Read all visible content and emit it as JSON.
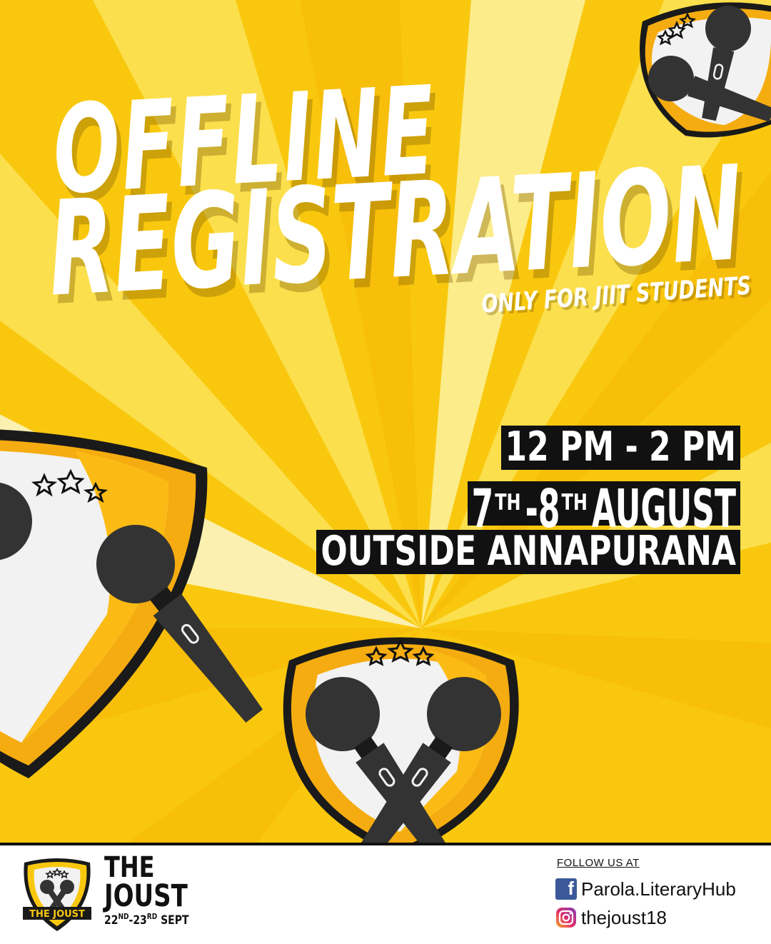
{
  "headline": {
    "line1": "OFFLINE",
    "line2": "REGISTRATION",
    "subline": "ONLY FOR JIIT STUDENTS"
  },
  "details": {
    "time": "12 PM - 2 PM",
    "date_day1": "7",
    "date_day1_suffix": "TH",
    "date_dash": " - ",
    "date_day2": "8",
    "date_day2_suffix": "TH",
    "date_month": "AUGUST",
    "venue": "OUTSIDE ANNAPURANA"
  },
  "footer": {
    "logo_banner": "THE JOUST",
    "brand_line1": "THE",
    "brand_line2": "JOUST",
    "dates_start": "22",
    "dates_start_suffix": "ND",
    "dates_dash": "-",
    "dates_end": "23",
    "dates_end_suffix": "RD",
    "dates_month": "SEPT",
    "follow_label": "FOLLOW US AT",
    "facebook_handle": "Parola.LiteraryHub",
    "instagram_handle": "thejoust18"
  },
  "icons": [
    "microphone-icon",
    "star-icon",
    "shield-icon",
    "facebook-icon",
    "instagram-icon"
  ],
  "colors": {
    "yellow": "#F9C80E",
    "light_yellow": "#FCEC8A",
    "orange": "#F5AC10",
    "dark": "#111111",
    "white": "#FFFFFF",
    "facebook": "#3B5998"
  }
}
